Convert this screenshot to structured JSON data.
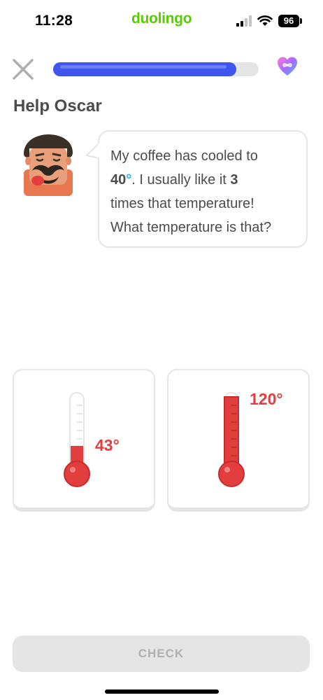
{
  "status_bar": {
    "time": "11:28",
    "app_name": "duolingo",
    "battery": "96",
    "icons": [
      "signal-icon",
      "wifi-icon",
      "battery-icon"
    ]
  },
  "header": {
    "close_icon": "close-icon",
    "progress_fraction": 0.89,
    "hearts_icon": "infinity-heart-icon"
  },
  "title": "Help Oscar",
  "character": {
    "icon": "oscar-avatar"
  },
  "speech": {
    "line1": "My coffee has cooled to",
    "number1": "40",
    "degree": "°",
    "text_mid": ". I usually like it ",
    "number2": "3",
    "line3": "times that temperature!",
    "line4": "What temperature is that?"
  },
  "options": [
    {
      "label": "43°",
      "fill_fraction": 0.31
    },
    {
      "label": "120°",
      "fill_fraction": 1.0
    }
  ],
  "check_button": "CHECK",
  "colors": {
    "brand_green": "#58cc02",
    "progress_blue": "#3e55ee",
    "temperature_red": "#e33e3e",
    "disabled_gray": "#e5e5e5",
    "degree_blue": "#1cb0f6"
  }
}
